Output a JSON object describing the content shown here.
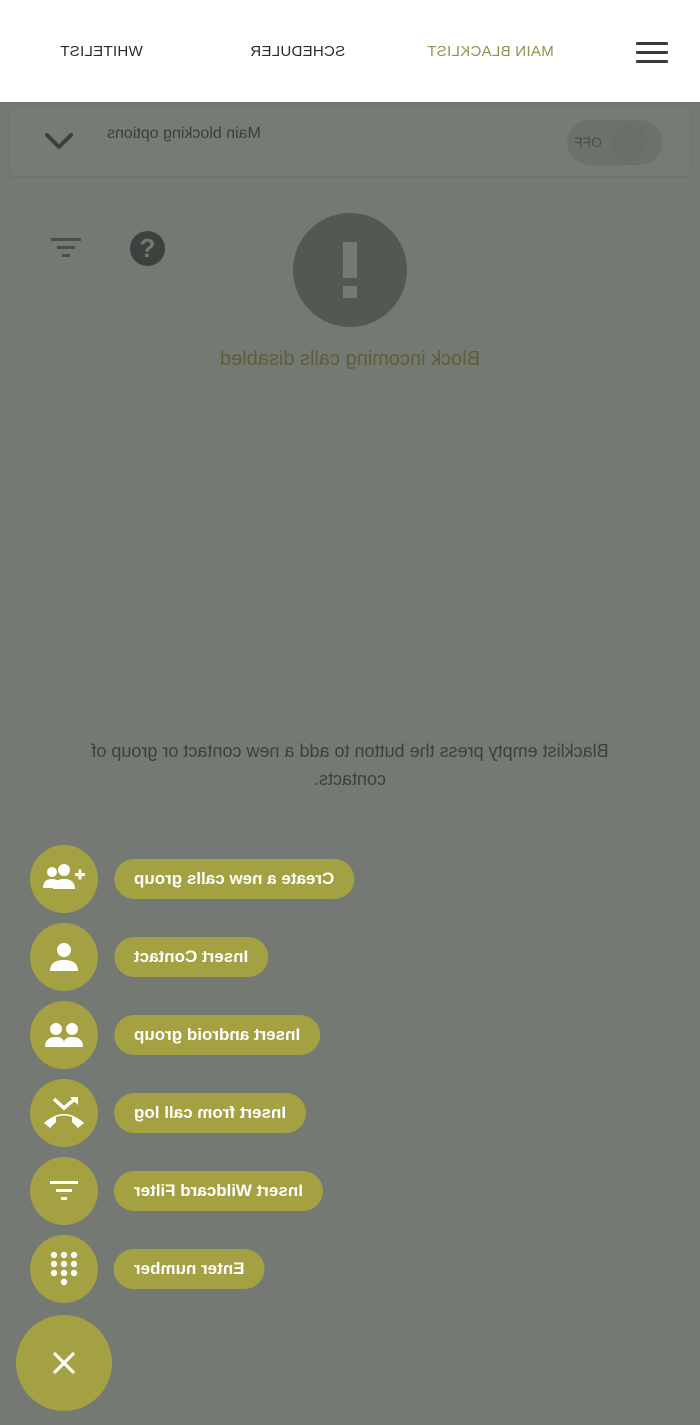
{
  "tabs": [
    {
      "label": "WHITELIST"
    },
    {
      "label": "SCHEDULER"
    },
    {
      "label": "MAIN BLACKLIST"
    }
  ],
  "options": {
    "label": "Main blocking options",
    "toggle_state": "OFF"
  },
  "status": {
    "warning": "Block incoming calls disabled",
    "empty_message": "Blacklist empty press the button to add a new contact or group of contacts."
  },
  "fab_actions": [
    {
      "label": "Create a new calls group",
      "icon": "group-add-icon"
    },
    {
      "label": "Insert Contact",
      "icon": "person-icon"
    },
    {
      "label": "Insert android group",
      "icon": "people-icon"
    },
    {
      "label": "Insert from call log",
      "icon": "call-missed-icon"
    },
    {
      "label": "Insert Wildcard Filter",
      "icon": "filter-icon"
    },
    {
      "label": "Enter number",
      "icon": "dialpad-icon"
    }
  ],
  "fab_close_icon": "close-icon",
  "colors": {
    "accent": "#a4a142",
    "active_tab": "#8d944e",
    "scrim": "#747973",
    "appbar": "#ffffff"
  }
}
